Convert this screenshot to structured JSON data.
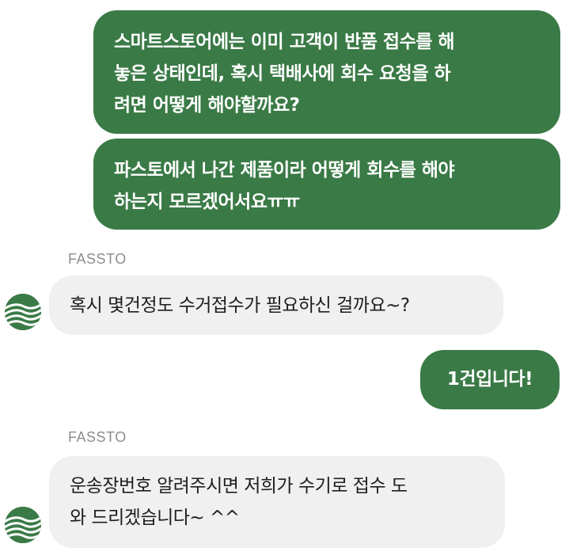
{
  "conversation": {
    "messages": [
      {
        "direction": "outgoing",
        "lines": [
          "스마트스토어에는 이미 고객이 반품 접수를 해",
          "놓은 상태인데, 혹시 택배사에 회수 요청을 하",
          "려면 어떻게 해야할까요?"
        ]
      },
      {
        "direction": "outgoing",
        "lines": [
          "파스토에서 나간 제품이라 어떻게 회수를 해야",
          "하는지 모르겠어서요ㅠㅠ"
        ]
      },
      {
        "direction": "incoming",
        "sender": "FASSTO",
        "lines": [
          "혹시 몇건정도 수거접수가 필요하신 걸까요~?"
        ]
      },
      {
        "direction": "outgoing",
        "lines": [
          "1건입니다!"
        ]
      },
      {
        "direction": "incoming",
        "sender": "FASSTO",
        "lines": [
          "운송장번호 알려주시면 저희가 수기로 접수 도",
          "와 드리겠습니다~ ^^"
        ]
      }
    ]
  },
  "avatar_icon": "fassto-logo-icon",
  "colors": {
    "outgoing_bubble": "#3a7a46",
    "incoming_bubble": "#f0f0f0",
    "sender_label": "#8d8d8d",
    "avatar": "#3a7a46"
  }
}
